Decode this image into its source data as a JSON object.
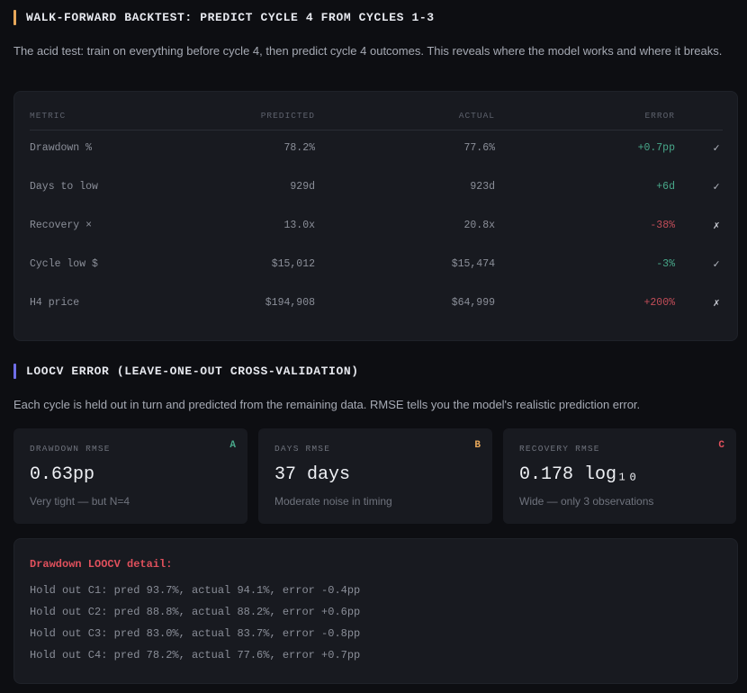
{
  "walk_forward": {
    "title": "WALK-FORWARD BACKTEST: PREDICT CYCLE 4 FROM CYCLES 1-3",
    "accent": "#e6a75a",
    "description": "The acid test: train on everything before cycle 4, then predict cycle 4 outcomes. This reveals where the model works and where it breaks.",
    "columns": [
      "METRIC",
      "PREDICTED",
      "ACTUAL",
      "ERROR"
    ],
    "rows": [
      {
        "metric": "Drawdown %",
        "predicted": "78.2%",
        "actual": "77.6%",
        "error": "+0.7pp",
        "status": "good",
        "mark": "✓"
      },
      {
        "metric": "Days to low",
        "predicted": "929d",
        "actual": "923d",
        "error": "+6d",
        "status": "good",
        "mark": "✓"
      },
      {
        "metric": "Recovery ×",
        "predicted": "13.0x",
        "actual": "20.8x",
        "error": "-38%",
        "status": "bad",
        "mark": "✗"
      },
      {
        "metric": "Cycle low $",
        "predicted": "$15,012",
        "actual": "$15,474",
        "error": "-3%",
        "status": "good",
        "mark": "✓"
      },
      {
        "metric": "H4 price",
        "predicted": "$194,908",
        "actual": "$64,999",
        "error": "+200%",
        "status": "bad",
        "mark": "✗"
      }
    ]
  },
  "loocv": {
    "title": "LOOCV ERROR (LEAVE-ONE-OUT CROSS-VALIDATION)",
    "accent": "#6f6ee8",
    "description": "Each cycle is held out in turn and predicted from the remaining data. RMSE tells you the model's realistic prediction error.",
    "cards": [
      {
        "label": "DRAWDOWN RMSE",
        "grade": "A",
        "grade_color": "#48a88a",
        "value": "0.63pp",
        "note": "Very tight — but N=4"
      },
      {
        "label": "DAYS RMSE",
        "grade": "B",
        "grade_color": "#e6a75a",
        "value": "37 days",
        "note": "Moderate noise in timing"
      },
      {
        "label": "RECOVERY RMSE",
        "grade": "C",
        "grade_color": "#e0505c",
        "value": "0.178 log₁₀",
        "note": "Wide — only 3 observations"
      }
    ],
    "detail": {
      "title": "Drawdown LOOCV detail:",
      "lines": [
        "Hold out C1: pred 93.7%, actual 94.1%, error -0.4pp",
        "Hold out C2: pred 88.8%, actual 88.2%, error +0.6pp",
        "Hold out C3: pred 83.0%, actual 83.7%, error -0.8pp",
        "Hold out C4: pred 78.2%, actual 77.6%, error +0.7pp"
      ]
    }
  }
}
